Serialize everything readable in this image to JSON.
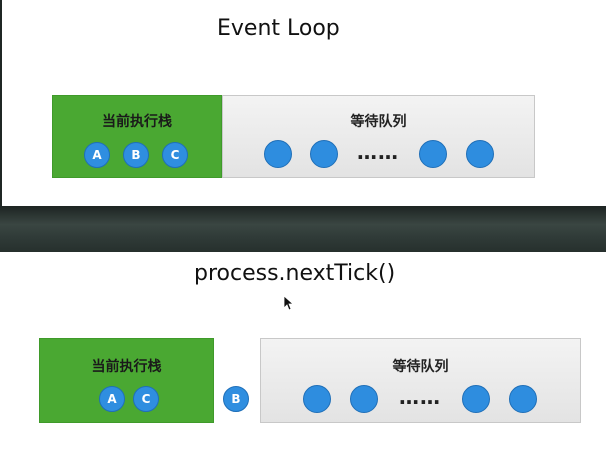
{
  "top": {
    "title": "Event Loop",
    "stack_label": "当前执行栈",
    "stack_items": [
      "A",
      "B",
      "C"
    ],
    "queue_label": "等待队列",
    "ellipsis": "……"
  },
  "bottom": {
    "title": "process.nextTick()",
    "stack_label": "当前执行栈",
    "stack_items": [
      "A",
      "C"
    ],
    "tick_item": "B",
    "queue_label": "等待队列",
    "ellipsis": "……"
  },
  "colors": {
    "stack_green": "#4aa832",
    "task_blue": "#2f8ee0",
    "queue_gray": "#e6e6e6"
  },
  "icons": {
    "pointer": "mouse-pointer-icon"
  }
}
